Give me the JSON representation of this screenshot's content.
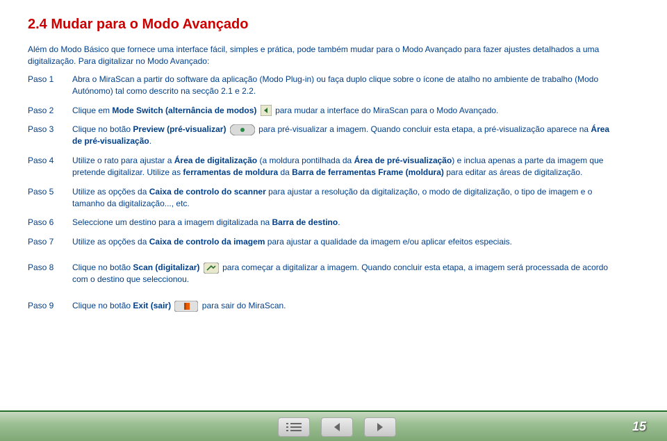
{
  "heading": "2.4 Mudar para o Modo Avançado",
  "intro": "Além do Modo Básico que fornece uma interface fácil, simples e prática, pode também mudar para o Modo Avançado para fazer ajustes detalhados a uma digitalização. Para digitalizar no Modo Avançado:",
  "steps": {
    "s1": {
      "num": "Paso 1",
      "text": "Abra o MiraScan a partir do software da aplicação (Modo Plug-in) ou faça duplo clique sobre o ícone de atalho no ambiente de trabalho (Modo Autónomo) tal como descrito na secção 2.1 e 2.2."
    },
    "s2": {
      "num": "Paso 2",
      "t1": "Clique em ",
      "b1": "Mode Switch (alternância de modos)",
      "t2": " para mudar a interface do MiraScan para o Modo Avançado."
    },
    "s3": {
      "num": "Paso 3",
      "t1": "Clique no botão ",
      "b1": "Preview (pré-visualizar)",
      "t2": " para pré-visualizar a imagem. Quando concluir esta etapa, a pré-visualização aparece na ",
      "b2": "Área de pré-visualização",
      "t3": "."
    },
    "s4": {
      "num": "Paso 4",
      "t1": "Utilize o rato para ajustar a ",
      "b1": "Área de digitalização",
      "t2": " (a moldura pontilhada da ",
      "b2": "Área de pré-visualização",
      "t3": ") e inclua apenas a parte da imagem que pretende digitalizar. Utilize as ",
      "b3": "ferramentas de moldura",
      "t4": " da ",
      "b4": "Barra de ferramentas Frame (moldura)",
      "t5": " para editar as áreas de digitalização."
    },
    "s5": {
      "num": "Paso 5",
      "t1": "Utilize as opções da ",
      "b1": "Caixa de controlo do scanner",
      "t2": " para ajustar a resolução da digitalização, o modo de digitalização, o tipo de imagem e o tamanho da digitalização..., etc."
    },
    "s6": {
      "num": "Paso 6",
      "t1": "Seleccione um destino para a imagem digitalizada na ",
      "b1": "Barra de destino",
      "t2": "."
    },
    "s7": {
      "num": "Paso 7",
      "t1": "Utilize as opções da ",
      "b1": "Caixa de controlo da imagem",
      "t2": " para ajustar a qualidade da imagem e/ou aplicar efeitos especiais."
    },
    "s8": {
      "num": "Paso 8",
      "t1": "Clique no botão ",
      "b1": "Scan (digitalizar)",
      "t2": " para começar a digitalizar a imagem. Quando concluir esta etapa, a imagem será processada de acordo com o destino que seleccionou."
    },
    "s9": {
      "num": "Paso 9",
      "t1": "Clique no botão ",
      "b1": "Exit (sair)",
      "t2": " para sair do MiraScan."
    }
  },
  "pageNumber": "15"
}
